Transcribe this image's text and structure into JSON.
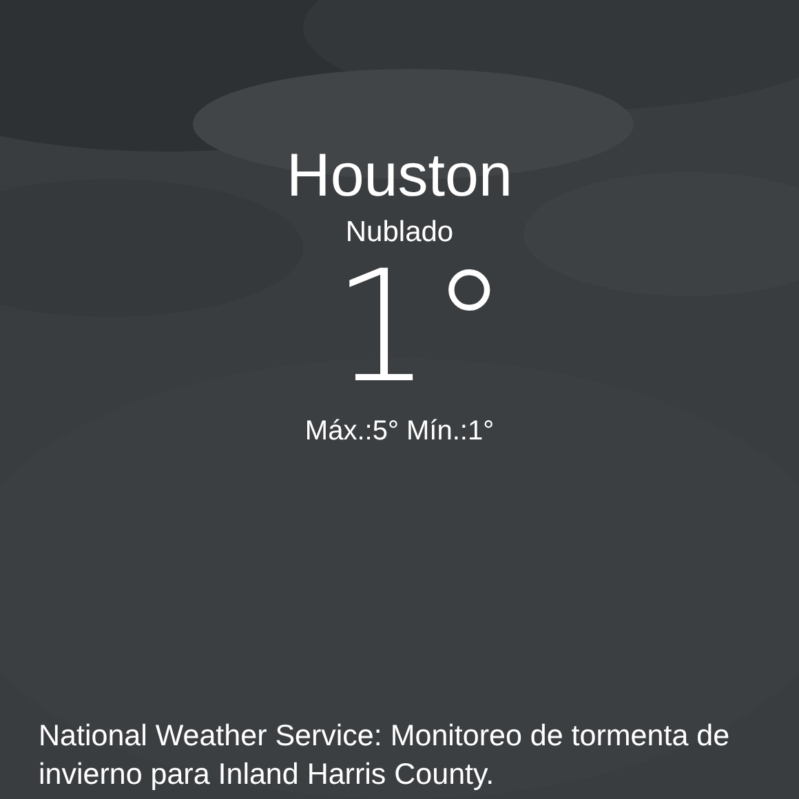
{
  "location": {
    "city": "Houston",
    "condition": "Nublado",
    "temperature": "1°",
    "high_low": "Máx.:5° Mín.:1°"
  },
  "alert": {
    "text": "National Weather Service: Monitoreo de tormenta de invierno para Inland Harris County."
  }
}
